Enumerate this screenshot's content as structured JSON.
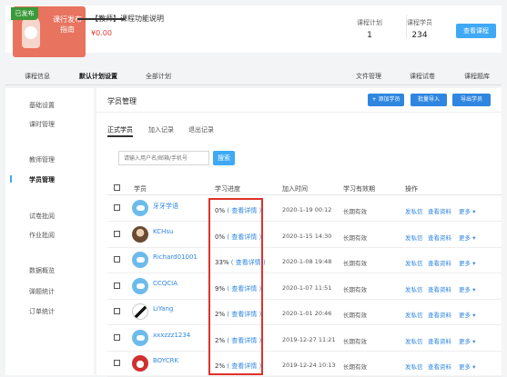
{
  "header": {
    "badge": "已发布",
    "cover_text": "课行发布指南",
    "title": "【教师】课程功能说明",
    "price": "¥0.00",
    "stats": [
      {
        "label": "课程计划",
        "value": "1"
      },
      {
        "label": "课程学员",
        "value": "234"
      }
    ],
    "view_course": "查看课程"
  },
  "tabs": {
    "left": [
      "课程信息",
      "默认计划设置",
      "全部计划"
    ],
    "right": [
      "文件管理",
      "课程试卷",
      "课程题库"
    ],
    "active_index": 1
  },
  "sidebar": {
    "items": [
      "基础设置",
      "课时管理",
      "教师管理",
      "学员管理",
      "试卷批阅",
      "作业批阅",
      "数据概览",
      "弹题统计",
      "订单统计"
    ],
    "active": "学员管理"
  },
  "main": {
    "title": "学员管理",
    "buttons": [
      "+ 添加学员",
      "批量导入",
      "导出学员"
    ],
    "subtabs": [
      "正式学员",
      "加入记录",
      "退出记录"
    ],
    "search_placeholder": "请输入用户名/邮箱/手机号",
    "search_button": "搜索",
    "columns": [
      "学员",
      "学习进度",
      "加入时间",
      "学习有效期",
      "操作"
    ]
  },
  "rows": [
    {
      "name": "牙牙学语",
      "progress": "0%",
      "detail": "( 查看详情 )",
      "joined": "2020-1-19 00:12",
      "validity": "长期有效",
      "avatar": "cloud"
    },
    {
      "name": "KCHsu",
      "progress": "0%",
      "detail": "( 查看详情 )",
      "joined": "2020-1-15 14:30",
      "validity": "长期有效",
      "avatar": "photo"
    },
    {
      "name": "Richard01001",
      "progress": "33%",
      "detail": "( 查看详情 )",
      "joined": "2020-1-08 19:48",
      "validity": "长期有效",
      "avatar": "cloud"
    },
    {
      "name": "CCQCIA",
      "progress": "9%",
      "detail": "( 查看详情 )",
      "joined": "2020-1-07 11:51",
      "validity": "长期有效",
      "avatar": "cloud"
    },
    {
      "name": "LiYang",
      "progress": "2%",
      "detail": "( 查看详情 )",
      "joined": "2020-1-01 20:46",
      "validity": "长期有效",
      "avatar": "bw"
    },
    {
      "name": "xxxzzz1234",
      "progress": "2%",
      "detail": "( 查看详情 )",
      "joined": "2019-12-27 11:21",
      "validity": "长期有效",
      "avatar": "cloud"
    },
    {
      "name": "BOYCRK",
      "progress": "2%",
      "detail": "( 查看详情 )",
      "joined": "2019-12-24 10:13",
      "validity": "长期有效",
      "avatar": "red"
    }
  ],
  "row_actions": [
    "发私信",
    "查看资料",
    "更多 ▾"
  ],
  "colors": {
    "accent": "#3fa9f5",
    "link": "#2f86e0",
    "highlight": "#e0302a",
    "badge": "#3a9a3a"
  }
}
